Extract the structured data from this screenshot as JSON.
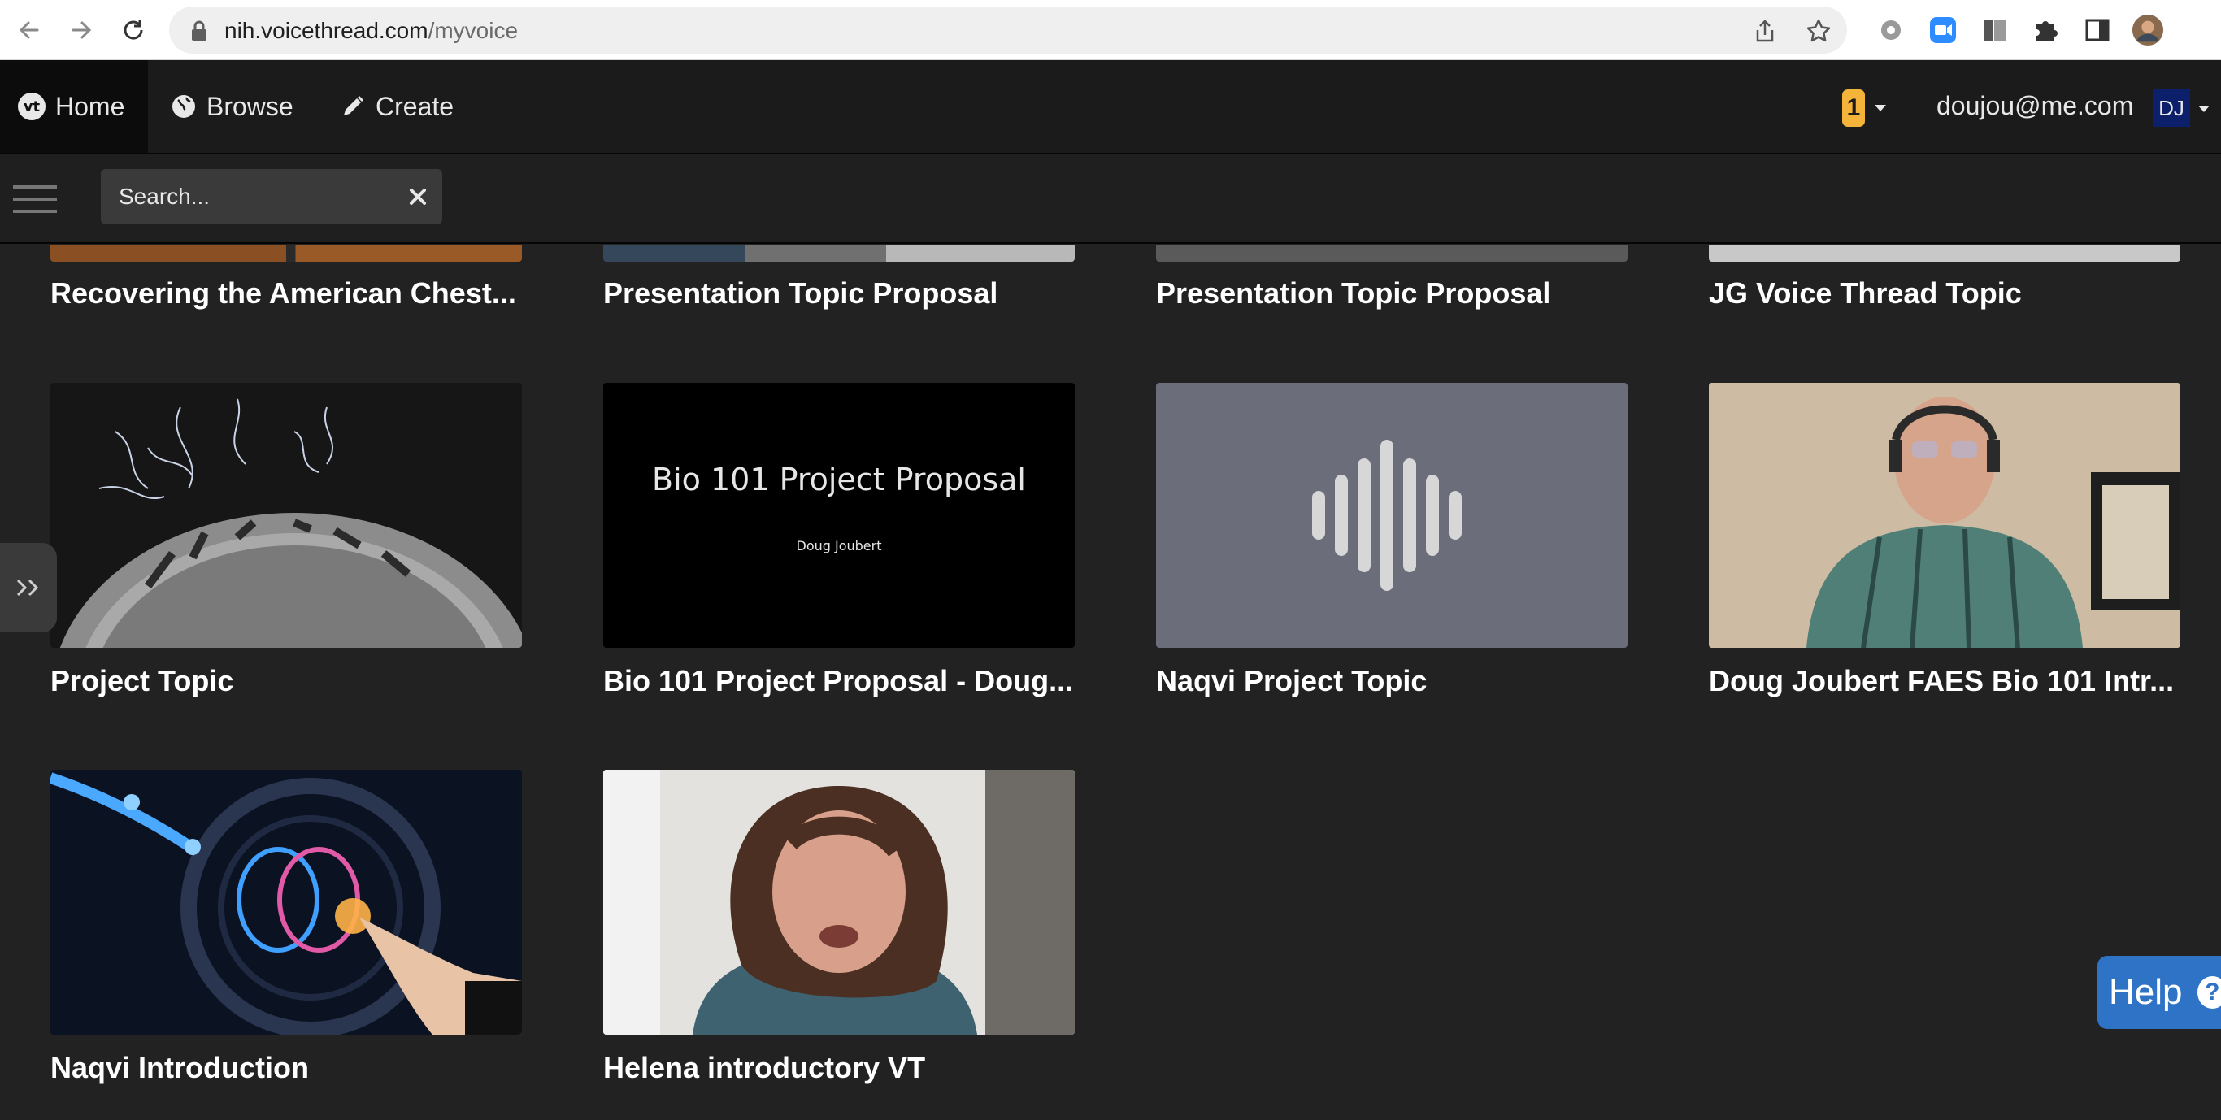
{
  "browser": {
    "url_host": "nih.voicethread.com",
    "url_path": "/myvoice"
  },
  "navbar": {
    "home_label": "Home",
    "browse_label": "Browse",
    "create_label": "Create",
    "notification_count": "1",
    "user_email": "doujou@me.com",
    "user_initials": "DJ",
    "logo_text": "vt"
  },
  "search": {
    "placeholder": "Search..."
  },
  "threads": [
    {
      "title": "Recovering the American Chest...",
      "thumb": "partial"
    },
    {
      "title": "Presentation Topic Proposal",
      "thumb": "partial"
    },
    {
      "title": "Presentation Topic Proposal",
      "thumb": "partial"
    },
    {
      "title": "JG Voice Thread Topic",
      "thumb": "partial"
    },
    {
      "title": "Project Topic",
      "thumb": "coin-image"
    },
    {
      "title": "Bio 101 Project Proposal - Doug...",
      "thumb": "title-slide",
      "slide_heading": "Bio 101 Project Proposal",
      "slide_author": "Doug Joubert"
    },
    {
      "title": "Naqvi Project Topic",
      "thumb": "audio-waveform"
    },
    {
      "title": "Doug Joubert FAES Bio 101 Intr...",
      "thumb": "webcam-video"
    },
    {
      "title": "Naqvi Introduction",
      "thumb": "brain-illustration"
    },
    {
      "title": "Helena introductory VT",
      "thumb": "webcam-video"
    }
  ],
  "help": {
    "label": "Help",
    "icon_text": "?"
  },
  "icons": [
    "back-arrow-icon",
    "forward-arrow-icon",
    "reload-icon",
    "lock-icon",
    "share-icon",
    "star-icon",
    "extension-icons",
    "globe-icon",
    "pencil-icon",
    "hamburger-icon",
    "close-icon",
    "double-chevron-icon"
  ]
}
